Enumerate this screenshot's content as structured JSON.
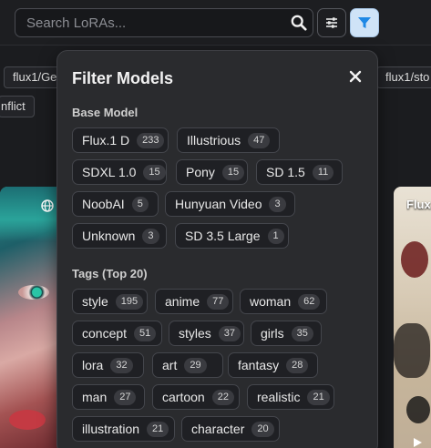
{
  "search": {
    "placeholder": "Search LoRAs..."
  },
  "background": {
    "chip_left": "flux1/Ge",
    "chip_left2": "nflict",
    "chip_right": "flux1/sto",
    "card_right_title": "Flux."
  },
  "filter": {
    "title": "Filter Models",
    "base_model": {
      "title": "Base Model",
      "items": [
        {
          "label": "Flux.1 D",
          "count": "233"
        },
        {
          "label": "Illustrious",
          "count": "47"
        },
        {
          "label": "SDXL 1.0",
          "count": "15"
        },
        {
          "label": "Pony",
          "count": "15"
        },
        {
          "label": "SD 1.5",
          "count": "11"
        },
        {
          "label": "NoobAI",
          "count": "5"
        },
        {
          "label": "Hunyuan Video",
          "count": "3"
        },
        {
          "label": "Unknown",
          "count": "3"
        },
        {
          "label": "SD 3.5 Large",
          "count": "1"
        }
      ]
    },
    "tags": {
      "title": "Tags (Top 20)",
      "items": [
        {
          "label": "style",
          "count": "195"
        },
        {
          "label": "anime",
          "count": "77"
        },
        {
          "label": "woman",
          "count": "62"
        },
        {
          "label": "concept",
          "count": "51"
        },
        {
          "label": "styles",
          "count": "37"
        },
        {
          "label": "girls",
          "count": "35"
        },
        {
          "label": "lora",
          "count": "32"
        },
        {
          "label": "art",
          "count": "29"
        },
        {
          "label": "fantasy",
          "count": "28"
        },
        {
          "label": "man",
          "count": "27"
        },
        {
          "label": "cartoon",
          "count": "22"
        },
        {
          "label": "realistic",
          "count": "21"
        },
        {
          "label": "illustration",
          "count": "21"
        },
        {
          "label": "character",
          "count": "20"
        }
      ]
    }
  },
  "colors": {
    "filter_active_bg": "#cfe3f7",
    "filter_icon": "#1e88e5",
    "panel_bg": "#2a2b2e"
  }
}
